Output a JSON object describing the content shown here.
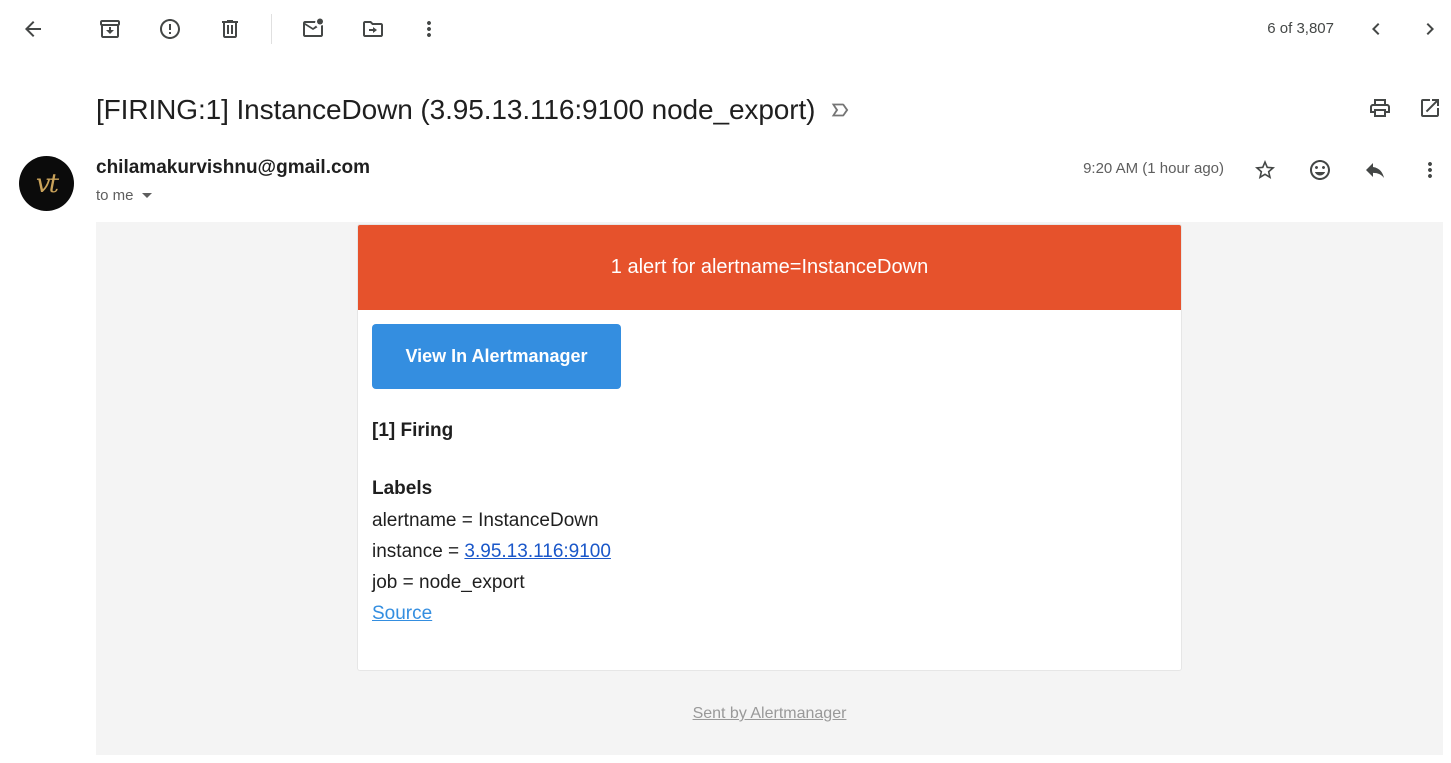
{
  "toolbar": {
    "buttons": [
      "back-arrow-icon",
      "archive-icon",
      "report-spam-icon",
      "delete-icon",
      "mark-unread-icon",
      "move-to-icon",
      "more-vert-icon"
    ],
    "pager": "6 of 3,807"
  },
  "email": {
    "subject": "[FIRING:1] InstanceDown (3.95.13.116:9100 node_export)",
    "sender": "chilamakurvishnu@gmail.com",
    "recipient": "to me",
    "time": "9:20 AM (1 hour ago)",
    "avatar_text": "vt"
  },
  "alert": {
    "header": "1 alert for alertname=InstanceDown",
    "header_color": "#e6522c",
    "button_label": "View In Alertmanager",
    "button_color": "#348ee0",
    "status": "[1] Firing",
    "labels_title": "Labels",
    "alertname_line": "alertname = InstanceDown",
    "instance_prefix": "instance = ",
    "instance_link": "3.95.13.116:9100",
    "job_line": "job = node_export",
    "source_link": "Source",
    "footer_link": "Sent by Alertmanager"
  }
}
